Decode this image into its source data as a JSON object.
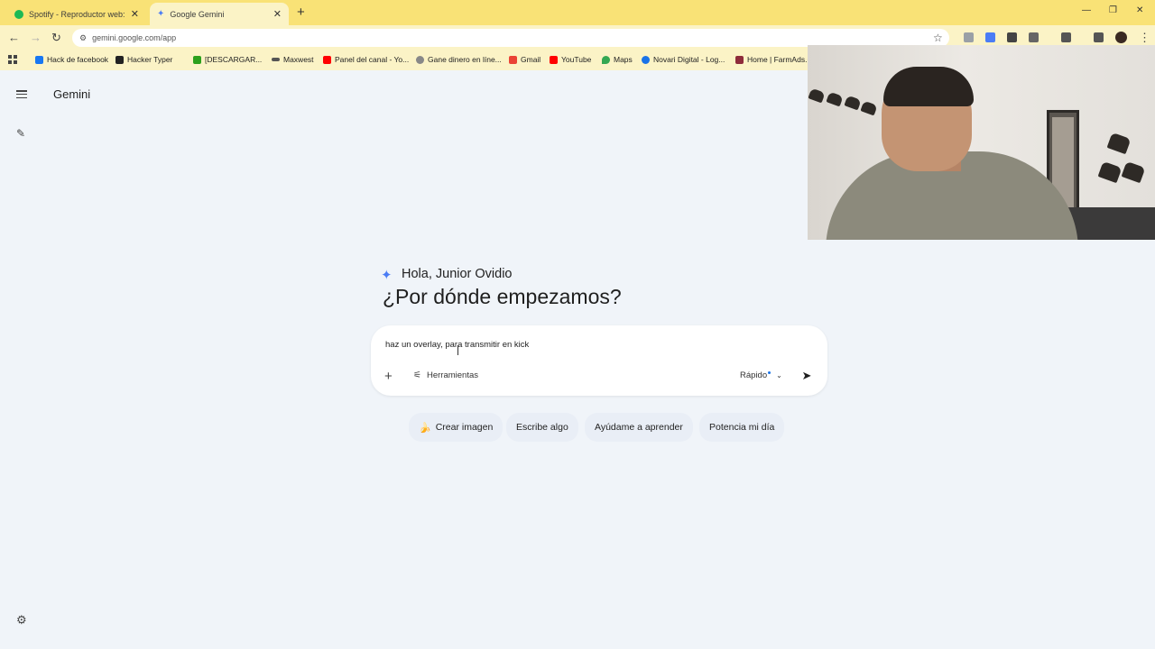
{
  "browser": {
    "tabs": [
      {
        "title": "Spotify - Reproductor web: mú",
        "favicon_color": "#1db954",
        "active": false
      },
      {
        "title": "Google Gemini",
        "favicon_color": "#4b7df5",
        "active": true
      }
    ],
    "url": "gemini.google.com/app",
    "bookmarks": [
      {
        "label": "Hack de facebook",
        "icon_color": "#1877f2"
      },
      {
        "label": "Hacker Typer",
        "icon_color": "#222222"
      },
      {
        "label": "[DESCARGAR...",
        "icon_color": "#2ca01c"
      },
      {
        "label": "Maxwest",
        "icon_color": "#555555"
      },
      {
        "label": "Panel del canal - Yo...",
        "icon_color": "#ff0000"
      },
      {
        "label": "Gane dinero en líne...",
        "icon_color": "#888888"
      },
      {
        "label": "Gmail",
        "icon_color": "#ea4335"
      },
      {
        "label": "YouTube",
        "icon_color": "#ff0000"
      },
      {
        "label": "Maps",
        "icon_color": "#34a853"
      },
      {
        "label": "Novari Digital - Log...",
        "icon_color": "#1a73e8"
      },
      {
        "label": "Home | FarmAds.C",
        "icon_color": "#8e2b3a"
      }
    ]
  },
  "app": {
    "name": "Gemini",
    "greeting": "Hola, Junior Ovidio",
    "headline": "¿Por dónde empezamos?"
  },
  "prompt": {
    "text": "haz un overlay, para transmitir en kick",
    "tools_label": "Herramientas",
    "model_label": "Rápido"
  },
  "chips": [
    {
      "label": "Crear imagen",
      "icon": "banana-icon"
    },
    {
      "label": "Escribe algo"
    },
    {
      "label": "Ayúdame a aprender"
    },
    {
      "label": "Potencia mi día"
    }
  ],
  "colors": {
    "tabstrip": "#f9e276",
    "toolbar": "#fbf3c6",
    "background": "#f0f4f9",
    "chip": "#e9eef6",
    "accent": "#4b7df5"
  }
}
